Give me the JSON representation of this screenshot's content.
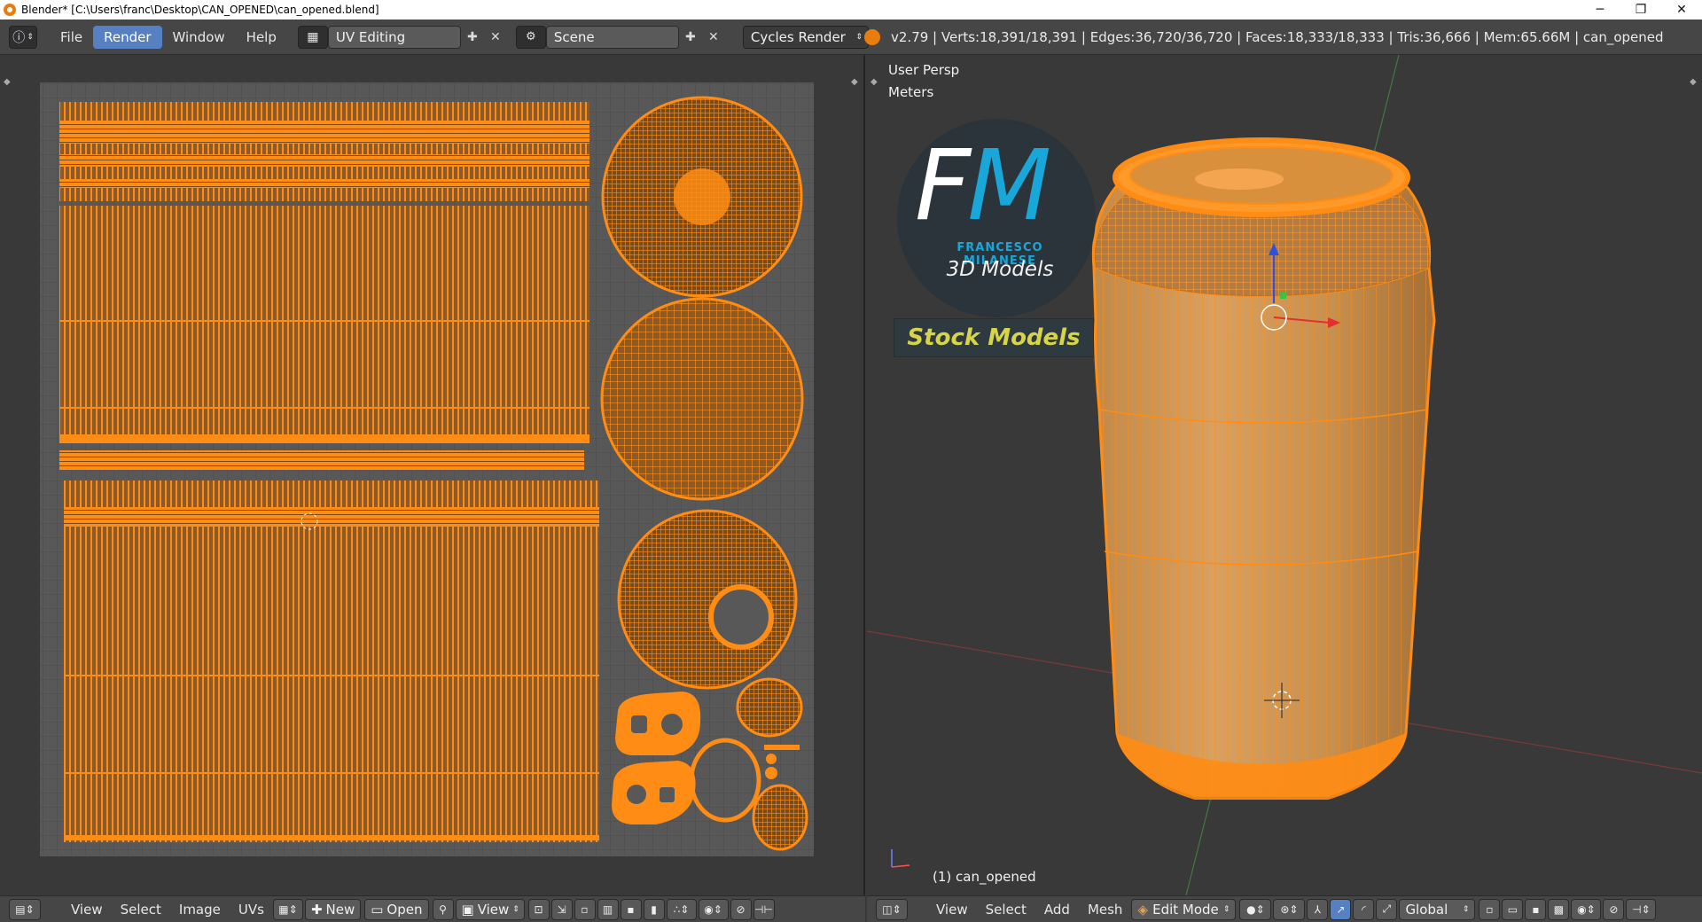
{
  "window": {
    "title": "Blender* [C:\\Users\\franc\\Desktop\\CAN_OPENED\\can_opened.blend]",
    "controls": [
      "─",
      "❐",
      "✕"
    ]
  },
  "menu": {
    "items": [
      "File",
      "Render",
      "Window",
      "Help"
    ],
    "active": "Render"
  },
  "screen_layout": {
    "label": "UV Editing"
  },
  "scene": {
    "label": "Scene"
  },
  "engine": {
    "label": "Cycles Render"
  },
  "stats": {
    "text": "v2.79 | Verts:18,391/18,391 | Edges:36,720/36,720 | Faces:18,333/18,333 | Tris:36,666 | Mem:65.66M | can_opened"
  },
  "uv_editor": {
    "menus": [
      "View",
      "Select",
      "Image",
      "UVs"
    ],
    "new_label": "New",
    "open_label": "Open",
    "view_label": "View"
  },
  "viewport": {
    "persp_label": "User Persp",
    "units_label": "Meters",
    "object_label": "(1) can_opened",
    "logo": {
      "f": "F",
      "m": "M",
      "name": "FRANCESCO MILANESE",
      "tagline": "3D Models",
      "stock": "Stock Models"
    },
    "menus": [
      "View",
      "Select",
      "Add",
      "Mesh"
    ],
    "mode_label": "Edit Mode",
    "orientation_label": "Global"
  },
  "colors": {
    "uv_orange": "#ff8c14",
    "selection_blue": "#5680c2",
    "logo_blue": "#19a6d8",
    "stock_yellow": "#d8d44a"
  }
}
